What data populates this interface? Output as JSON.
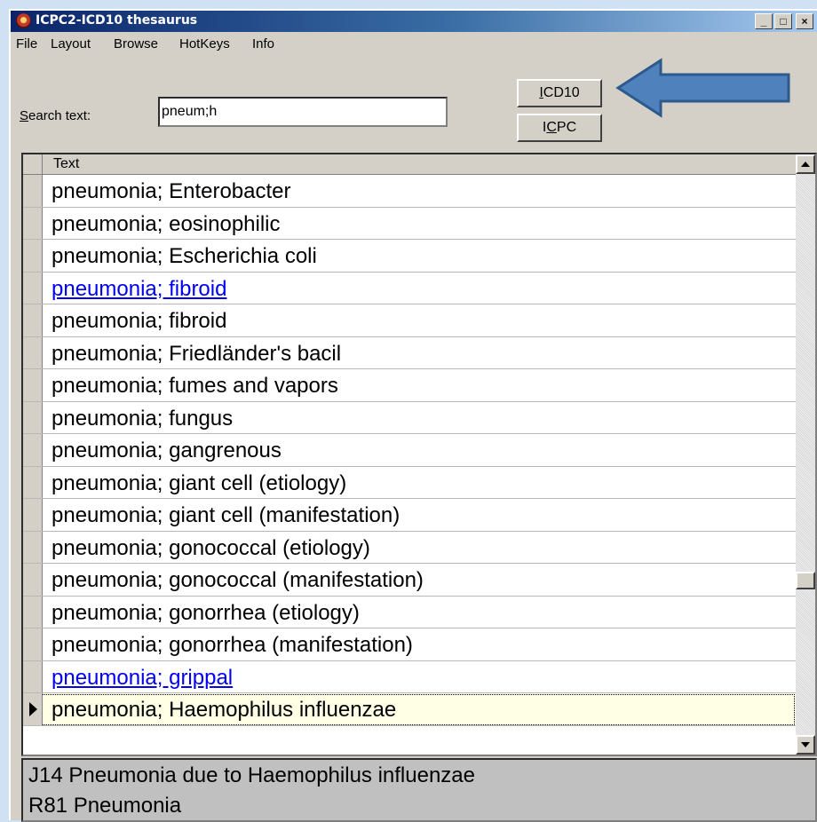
{
  "window": {
    "title": "ICPC2-ICD10 thesaurus"
  },
  "menu": [
    "File",
    "Layout",
    "Browse",
    "HotKeys",
    "Info"
  ],
  "search": {
    "label_prefix": "S",
    "label_rest": "earch text:",
    "value": "pneum;h"
  },
  "buttons": {
    "icd10": {
      "u": "I",
      "rest": "CD10"
    },
    "icpc": {
      "pre": "I",
      "u": "C",
      "rest": "PC"
    }
  },
  "grid": {
    "column_header": "Text",
    "rows": [
      {
        "text": "pneumonia; Enterobacter",
        "style": "normal"
      },
      {
        "text": "pneumonia; eosinophilic",
        "style": "normal"
      },
      {
        "text": "pneumonia; Escherichia coli",
        "style": "normal"
      },
      {
        "text": "pneumonia; fibroid",
        "style": "link"
      },
      {
        "text": "pneumonia; fibroid",
        "style": "normal"
      },
      {
        "text": "pneumonia; Friedländer's bacil",
        "style": "normal"
      },
      {
        "text": "pneumonia; fumes and vapors",
        "style": "normal"
      },
      {
        "text": "pneumonia; fungus",
        "style": "normal"
      },
      {
        "text": "pneumonia; gangrenous",
        "style": "normal"
      },
      {
        "text": "pneumonia; giant cell (etiology)",
        "style": "normal"
      },
      {
        "text": "pneumonia; giant cell (manifestation)",
        "style": "normal"
      },
      {
        "text": "pneumonia; gonococcal (etiology)",
        "style": "normal"
      },
      {
        "text": "pneumonia; gonococcal (manifestation)",
        "style": "normal"
      },
      {
        "text": "pneumonia; gonorrhea (etiology)",
        "style": "normal"
      },
      {
        "text": "pneumonia; gonorrhea (manifestation)",
        "style": "normal"
      },
      {
        "text": "pneumonia; grippal",
        "style": "link"
      },
      {
        "text": "pneumonia; Haemophilus influenzae",
        "style": "current"
      }
    ]
  },
  "codes": [
    "J14 Pneumonia due to Haemophilus influenzae",
    "R81 Pneumonia"
  ],
  "colors": {
    "link": "#0000ee",
    "titlebar": "#0a246a",
    "arrow": "#4f81bd"
  }
}
